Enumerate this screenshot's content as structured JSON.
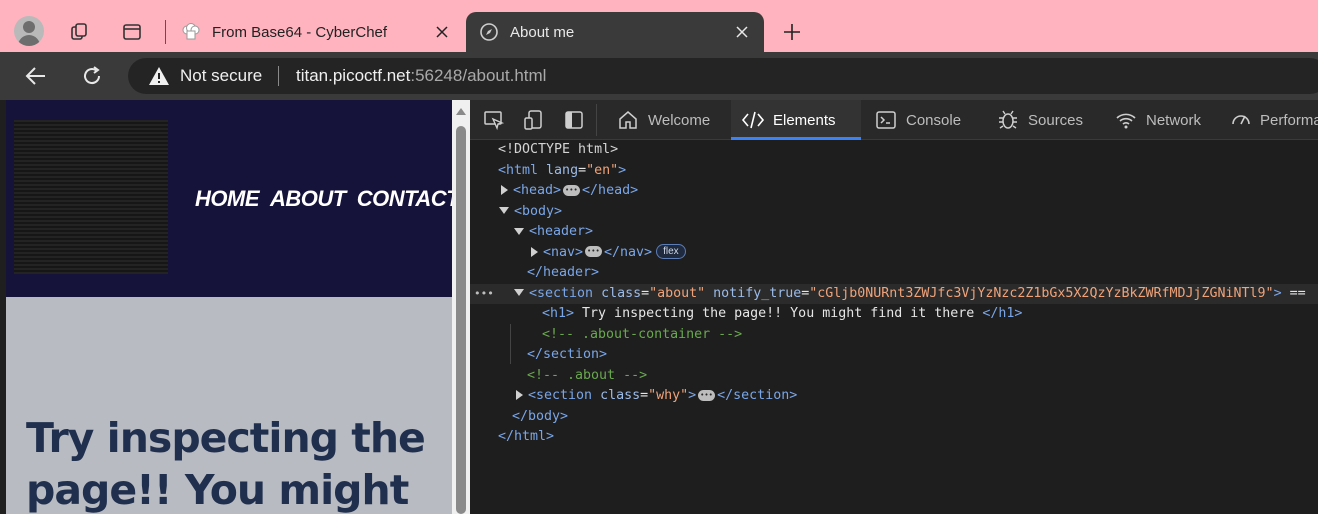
{
  "browser": {
    "tabs": [
      {
        "title": "From Base64 - CyberChef",
        "active": false
      },
      {
        "title": "About me",
        "active": true
      }
    ],
    "address_bar": {
      "security_label": "Not secure",
      "host": "titan.picoctf.net",
      "rest": ":56248/about.html"
    }
  },
  "page": {
    "nav": [
      "HOME",
      "ABOUT",
      "CONTACT"
    ],
    "heading": "Try inspecting the page!! You might"
  },
  "devtools": {
    "tabs": [
      {
        "label": "Welcome",
        "icon": "home-icon"
      },
      {
        "label": "Elements",
        "icon": "code-icon",
        "active": true
      },
      {
        "label": "Console",
        "icon": "console-icon"
      },
      {
        "label": "Sources",
        "icon": "bug-icon"
      },
      {
        "label": "Network",
        "icon": "wifi-icon"
      },
      {
        "label": "Performa",
        "icon": "gauge-icon"
      }
    ],
    "dom": {
      "doctype": "<!DOCTYPE html>",
      "html_open": "<html",
      "html_attr": "lang",
      "html_val": "\"en\"",
      "head": "<head>",
      "head_close": "</head>",
      "body": "<body>",
      "header": "<header>",
      "nav": "<nav>",
      "nav_close": "</nav>",
      "flex_badge": "flex",
      "header_close": "</header>",
      "section_open": "<section",
      "section_class_attr": "class",
      "section_class_val": "\"about\"",
      "notify_attr": "notify_true",
      "notify_val": "\"cGljb0NURnt3ZWJfc3VjYzNzc2Z1bGx5X2QzYzBkZWRfMDJjZGNiNTl9\"",
      "eq": "==",
      "h1_open": "<h1>",
      "h1_text": " Try inspecting the page!! You might find it there ",
      "h1_close": "</h1>",
      "comment_about_container": "<!-- .about-container -->",
      "section_close": "</section>",
      "comment_about": "<!-- .about -->",
      "why_val": "\"why\"",
      "body_close": "</body>",
      "html_close": "</html>"
    }
  }
}
